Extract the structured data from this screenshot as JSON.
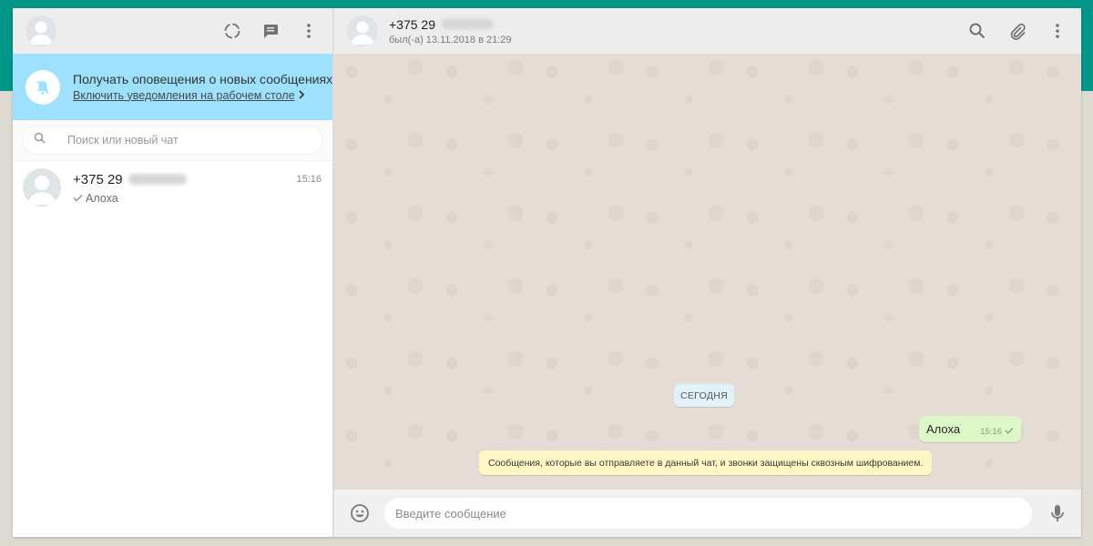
{
  "colors": {
    "accent": "#009688",
    "notification_bg": "#9de1fe",
    "outgoing_bubble": "#dcf8c6",
    "notice_bg": "#fff6c5",
    "date_chip_bg": "#e1f2fb"
  },
  "sidebar": {
    "header_icons": [
      "status-icon",
      "new-chat-icon",
      "menu-icon"
    ],
    "notification": {
      "title": "Получать оповещения о новых сообщениях",
      "link": "Включить уведомления на рабочем столе",
      "icon": "bell-off-icon"
    },
    "search": {
      "placeholder": "Поиск или новый чат",
      "icon": "search-icon"
    },
    "chats": [
      {
        "name": "+375 29",
        "time": "15:16",
        "preview": "Алоха",
        "status_icon": "check-icon"
      }
    ]
  },
  "conversation": {
    "title": "+375 29",
    "status": "был(-а) 13.11.2018 в 21:29",
    "header_icons": [
      "search-icon",
      "attach-icon",
      "menu-icon"
    ],
    "date_chip": "СЕГОДНЯ",
    "messages": [
      {
        "direction": "out",
        "text": "Алоха",
        "time": "15:16",
        "status_icon": "check-icon"
      }
    ],
    "encryption_notice": "Сообщения, которые вы отправляете в данный чат, и звонки защищены сквозным шифрованием."
  },
  "composer": {
    "placeholder": "Введите сообщение",
    "emoji_icon": "emoji-icon",
    "mic_icon": "mic-icon"
  }
}
